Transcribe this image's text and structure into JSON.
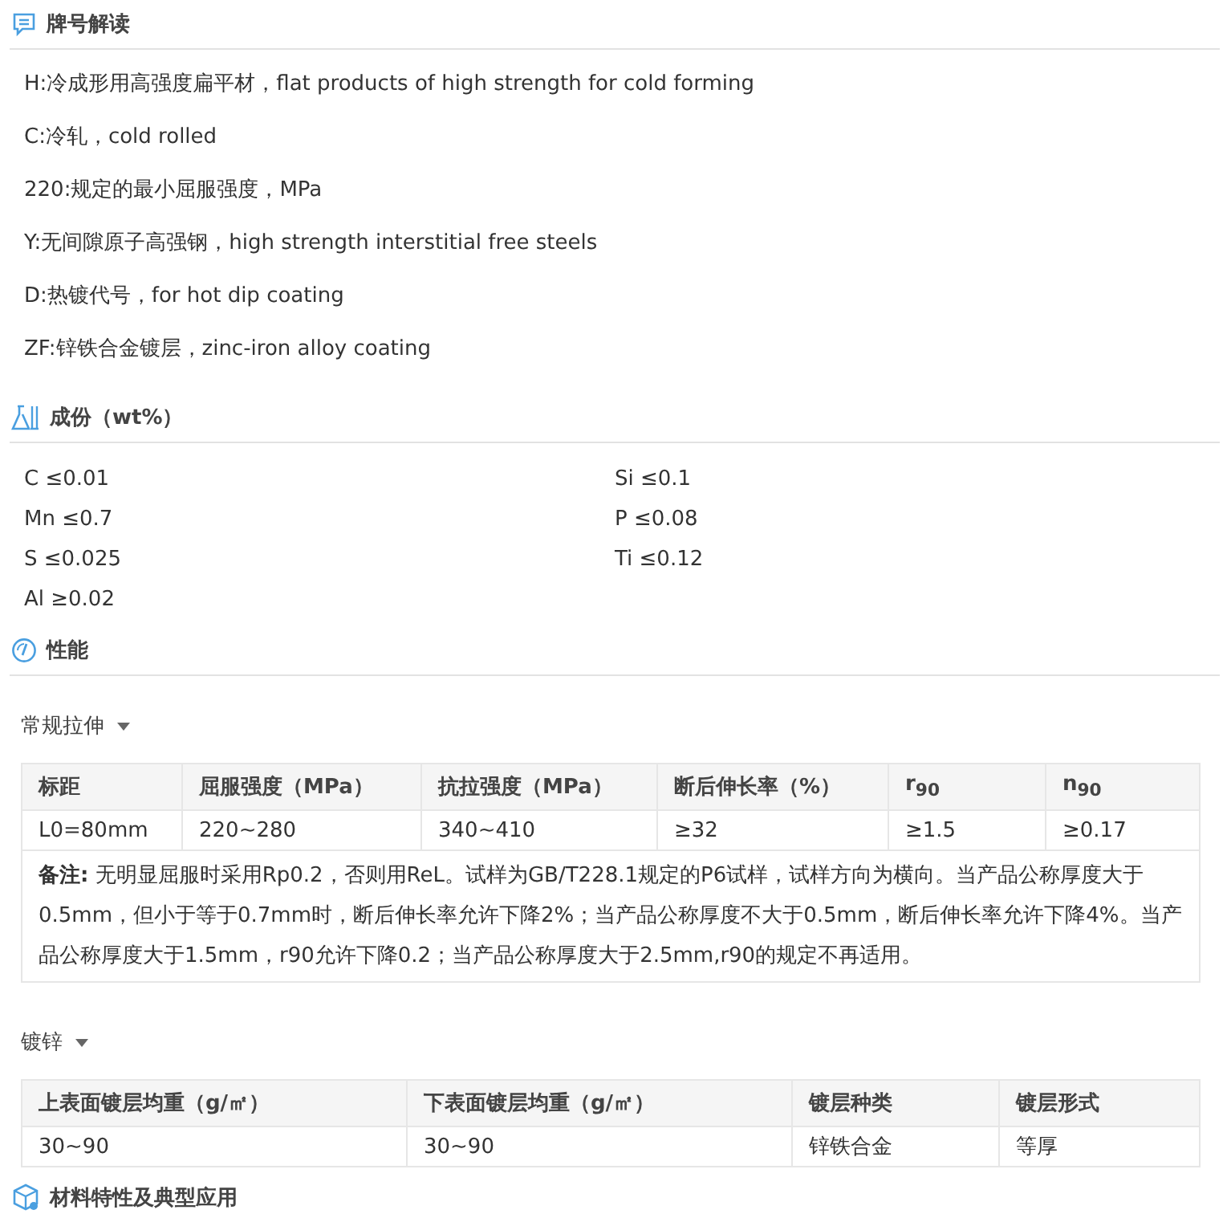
{
  "sections": [
    {
      "kind": "designation",
      "title": "牌号解读",
      "lines": [
        "H:冷成形用高强度扁平材，flat products of high strength for cold forming",
        "C:冷轧，cold rolled",
        "220:规定的最小屈服强度，MPa",
        "Y:无间隙原子高强钢，high strength interstitial free steels",
        "D:热镀代号，for hot dip coating",
        "ZF:锌铁合金镀层，zinc-iron alloy coating"
      ]
    },
    {
      "kind": "composition",
      "title": "成份（wt%）",
      "elements": [
        "C ≤0.01",
        "Si ≤0.1",
        "Mn ≤0.7",
        "P ≤0.08",
        "S ≤0.025",
        "Ti ≤0.12",
        "Al ≥0.02"
      ]
    },
    {
      "kind": "properties",
      "title": "性能",
      "groups": [
        {
          "label": "常规拉伸",
          "columns": [
            "标距",
            "屈服强度（MPa）",
            "抗拉强度（MPa）",
            "断后伸长率（%）",
            "r$_{90}$",
            "n$_{90}$"
          ],
          "rows": [
            [
              "L0=80mm",
              "220~280",
              "340~410",
              "≥32",
              "≥1.5",
              "≥0.17"
            ]
          ],
          "note": "**备注:** 无明显屈服时采用Rp0.2，否则用ReL。试样为GB/T228.1规定的P6试样，试样方向为横向。当产品公称厚度大于0.5mm，但小于等于0.7mm时，断后伸长率允许下降2%；当产品公称厚度不大于0.5mm，断后伸长率允许下降4%。当产品公称厚度大于1.5mm，r90允许下降0.2；当产品公称厚度大于2.5mm,r90的规定不再适用。"
        },
        {
          "label": "镀锌",
          "columns": [
            "上表面镀层均重（g/㎡）",
            "下表面镀层均重（g/㎡）",
            "镀层种类",
            "镀层形式"
          ],
          "rows": [
            [
              "30~90",
              "30~90",
              "锌铁合金",
              "等厚"
            ]
          ]
        }
      ]
    },
    {
      "kind": "application",
      "title": "材料特性及典型应用"
    }
  ]
}
